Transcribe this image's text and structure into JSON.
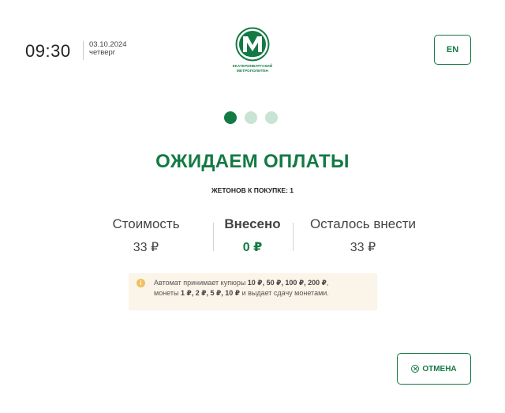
{
  "header": {
    "time": "09:30",
    "date": "03.10.2024",
    "weekday": "четверг",
    "logo_text_line1": "ЕКАТЕРИНБУРГСКИЙ",
    "logo_text_line2": "МЕТРОПОЛИТЕН",
    "lang_button": "EN"
  },
  "steps": {
    "total": 3,
    "current": 1
  },
  "main": {
    "title": "ОЖИДАЕМ ОПЛАТЫ",
    "tokens_label": "ЖЕТОНОВ К ПОКУПКЕ:",
    "tokens_count": "1"
  },
  "payment": {
    "cost_label": "Стоимость",
    "cost_value": "33 ₽",
    "paid_label": "Внесено",
    "paid_value": "0 ₽",
    "remain_label": "Осталось внести",
    "remain_value": "33 ₽"
  },
  "notice": {
    "icon": "info-icon",
    "p1": "Автомат принимает купюры ",
    "b1": "10 ₽, 50 ₽, 100 ₽, 200 ₽",
    "p2": ",",
    "p3": "монеты ",
    "b2": "1 ₽, 2 ₽, 5 ₽, 10 ₽",
    "p4": " и выдает сдачу монетами."
  },
  "actions": {
    "cancel_label": "ОТМЕНА",
    "cancel_icon": "close-circle-icon"
  },
  "colors": {
    "accent": "#137a44",
    "dot_inactive": "#c9e3d4",
    "notice_bg": "#fbf4e8"
  }
}
